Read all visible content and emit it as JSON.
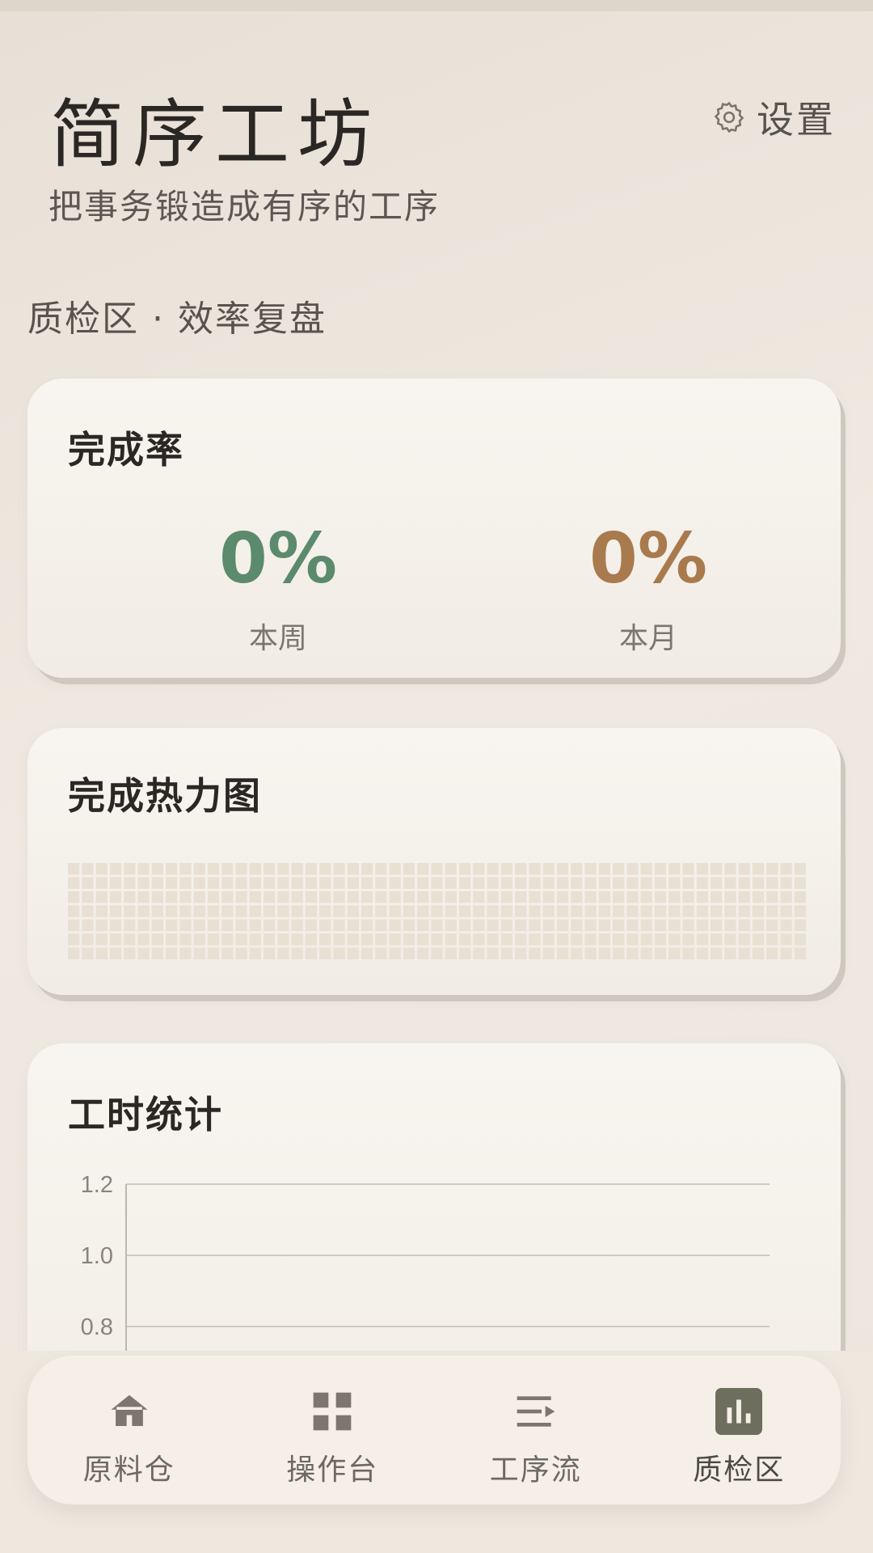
{
  "app": {
    "title": "简序工坊",
    "subtitle": "把事务锻造成有序的工序",
    "settings_label": "设置"
  },
  "section_label": "质检区 · 效率复盘",
  "completion_card": {
    "title": "完成率",
    "week": {
      "value": "0%",
      "label": "本周",
      "color": "#5b8a6d"
    },
    "month": {
      "value": "0%",
      "label": "本月",
      "color": "#a97a4d"
    }
  },
  "heatmap_card": {
    "title": "完成热力图",
    "cell_color": "#e8e0d3",
    "rows": 7,
    "cols": 53
  },
  "hours_card": {
    "title": "工时统计",
    "y_ticks": [
      "1.2",
      "1.0",
      "0.8"
    ]
  },
  "nav": {
    "items": [
      {
        "label": "原料仓",
        "icon": "home-icon",
        "active": false
      },
      {
        "label": "操作台",
        "icon": "grid-icon",
        "active": false
      },
      {
        "label": "工序流",
        "icon": "list-flow-icon",
        "active": false
      },
      {
        "label": "质检区",
        "icon": "bar-chart-icon",
        "active": true
      }
    ],
    "active_color": "#6d6e5e"
  },
  "chart_data": {
    "type": "line",
    "title": "工时统计",
    "xlabel": "",
    "ylabel": "",
    "yticks": [
      1.2,
      1.0,
      0.8
    ],
    "series": []
  }
}
